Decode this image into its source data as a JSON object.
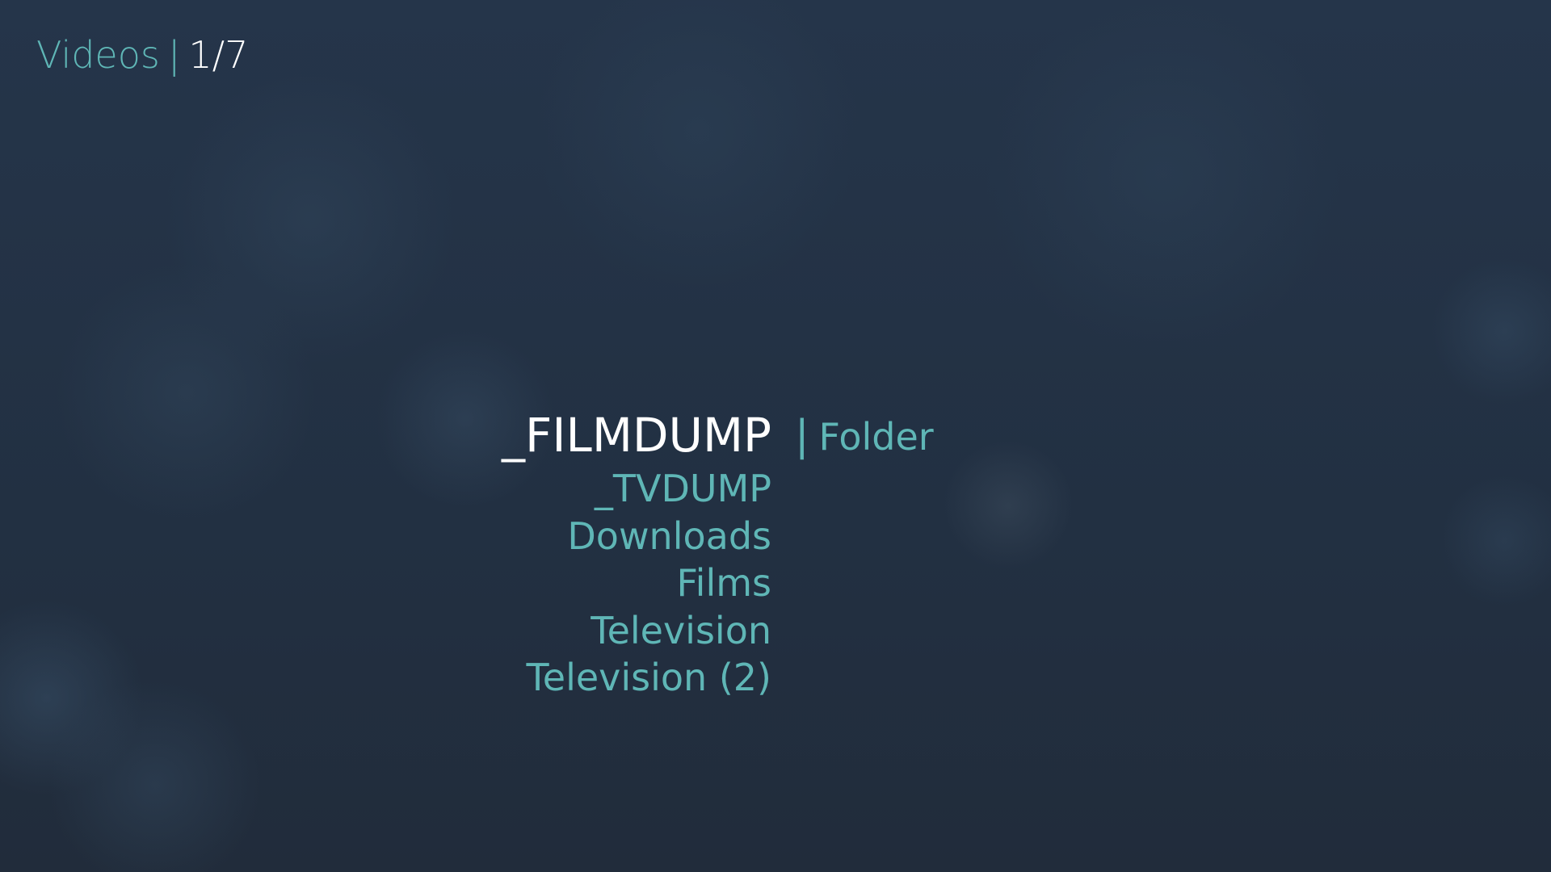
{
  "header": {
    "section": "Videos",
    "separator": "|",
    "position": "1/7"
  },
  "list": {
    "items": [
      {
        "label": "_FILMDUMP",
        "selected": true
      },
      {
        "label": "_TVDUMP",
        "selected": false
      },
      {
        "label": "Downloads",
        "selected": false
      },
      {
        "label": "Films",
        "selected": false
      },
      {
        "label": "Television",
        "selected": false
      },
      {
        "label": "Television (2)",
        "selected": false
      }
    ]
  },
  "selected_info": {
    "separator": "|",
    "type": "Folder"
  },
  "colors": {
    "accent": "#5fb6b6",
    "selected_text": "#ffffff",
    "background": "#24303f"
  }
}
